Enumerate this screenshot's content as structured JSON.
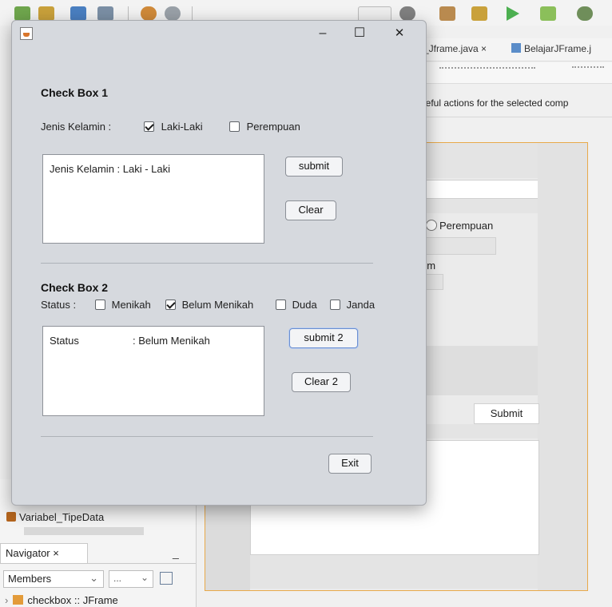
{
  "ide": {
    "tabs": [
      "_Jframe.java ×",
      "BelajarJFrame.j"
    ],
    "hint_text": "useful actions for the selected comp",
    "designer": {
      "radio_label": "Perempuan",
      "partial_label": "um",
      "submit_label": "Submit"
    },
    "project_item": "Variabel_TipeData",
    "navigator": {
      "tab_label": "Navigator ×",
      "minimize": "_",
      "members_label": "Members",
      "filter_label": "...",
      "tree_item": "checkbox :: JFrame"
    }
  },
  "dialog": {
    "window_controls": {
      "minimize": "–",
      "maximize": "☐",
      "close": "✕"
    },
    "section1": {
      "title": "Check Box 1",
      "gender_label": "Jenis Kelamin :",
      "options": [
        {
          "label": "Laki-Laki",
          "checked": true
        },
        {
          "label": "Perempuan",
          "checked": false
        }
      ],
      "output": "Jenis Kelamin  : Laki - Laki",
      "submit_label": "submit",
      "clear_label": "Clear"
    },
    "section2": {
      "title": "Check Box 2",
      "status_label": "Status  :",
      "options": [
        {
          "label": "Menikah",
          "checked": false
        },
        {
          "label": "Belum Menikah",
          "checked": true
        },
        {
          "label": "Duda",
          "checked": false
        },
        {
          "label": "Janda",
          "checked": false
        }
      ],
      "output_key": "Status",
      "output_value": ": Belum Menikah",
      "submit_label": "submit 2",
      "clear_label": "Clear 2"
    },
    "exit_label": "Exit"
  }
}
